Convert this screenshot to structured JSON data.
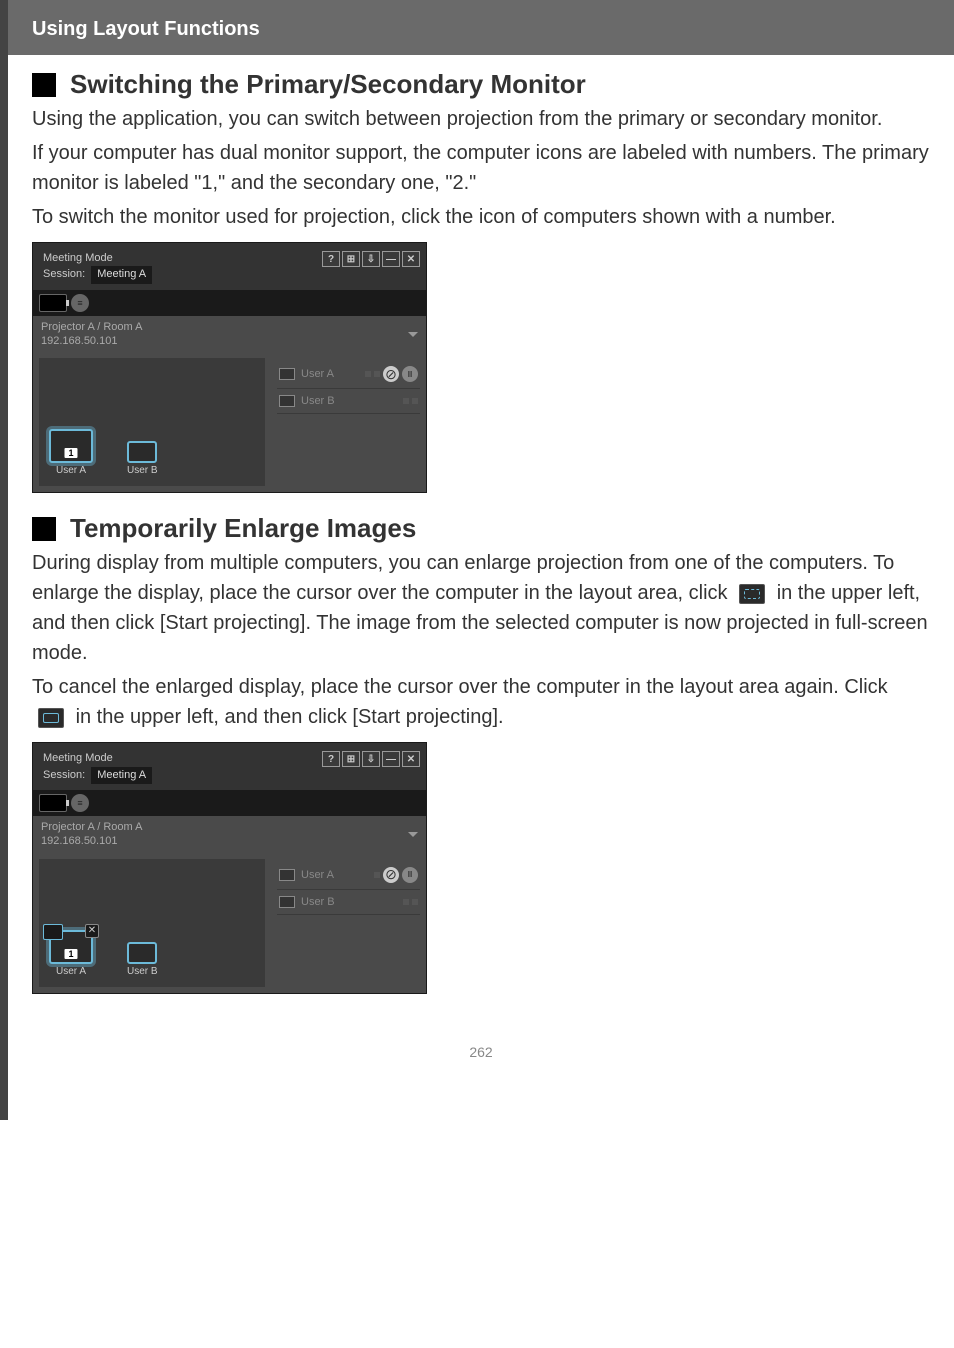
{
  "header": {
    "title": "Using Layout Functions"
  },
  "section1": {
    "title": "Switching the Primary/Secondary Monitor",
    "para1": "Using the application, you can switch between projection from the primary or secondary monitor.",
    "para2": "If your computer has dual monitor support, the computer icons are labeled with numbers. The primary monitor is labeled \"1,\" and the secondary one, \"2.\"",
    "para3": "To switch the monitor used for projection, click the icon of computers shown with a number."
  },
  "section2": {
    "title": "Temporarily Enlarge Images",
    "para1_a": "During display from multiple computers, you can enlarge projection from one of the computers. To enlarge the display, place the cursor over the computer in the layout area, click ",
    "para1_b": " in the upper left, and then click [Start projecting]. The image from the selected computer is now projected in full-screen mode.",
    "para2_a": "To cancel the enlarged display, place the cursor over the computer in the layout area again. Click ",
    "para2_b": " in the upper left, and then click [Start projecting]."
  },
  "app": {
    "meeting_mode_label": "Meeting Mode",
    "session_label": "Session:",
    "session_name": "Meeting A",
    "titlebar_icons": {
      "help": "?",
      "grid": "⊞",
      "download": "⇩",
      "minimize": "—",
      "close": "✕"
    },
    "projector": {
      "name": "Projector A / Room A",
      "ip": "192.168.50.101"
    },
    "computers": [
      {
        "label": "User A",
        "badge": "1"
      },
      {
        "label": "User B"
      }
    ],
    "users": [
      {
        "name": "User A",
        "active": true
      },
      {
        "name": "User B",
        "active": false
      }
    ],
    "list_glyph": "≡",
    "pause_glyph": "II",
    "close_glyph": "✕"
  },
  "page_number": "262"
}
